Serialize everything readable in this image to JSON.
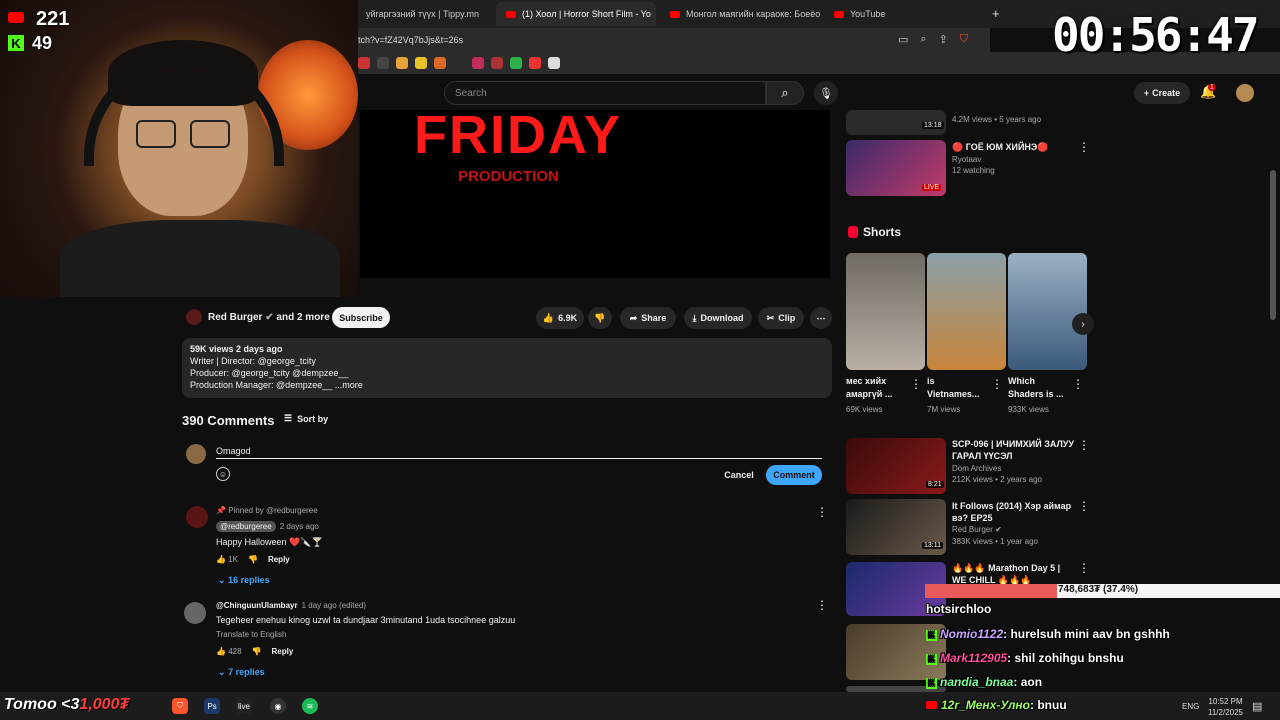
{
  "browser": {
    "tabs": [
      {
        "label": "уйгаргэзний түүх | Tippy.mn",
        "active": false
      },
      {
        "label": "(1) Хоол | Horror Short Film - Yo",
        "active": true
      },
      {
        "label": "Монгол маягийн караоке: Боеёо, А",
        "active": false
      },
      {
        "label": "YouTube",
        "active": false
      }
    ],
    "url": "tch?v=fZ42Vq7bJjs&t=26s",
    "new_tab": "+"
  },
  "stream": {
    "youtube_viewers": "221",
    "kick_viewers": "49",
    "timer": "00:56:47",
    "donation_bar": "748,683₮ (37.4%)",
    "donation_fraction": 0.374,
    "taskbar_overlay_name": "Tomoo <3",
    "taskbar_overlay_amount": "1,000₮",
    "chat": [
      {
        "user": "hotsirchloo",
        "text": ""
      },
      {
        "user": "Nomio1122",
        "text": ": hurelsuh mini aav bn gshhh"
      },
      {
        "user": "Mark112905",
        "text": ": shil zohihgu bnshu"
      },
      {
        "user": "nandia_bnaa",
        "text": ": aon"
      },
      {
        "user": "12r_Менх-Улно",
        "text": ": bnuu"
      }
    ]
  },
  "youtube": {
    "search_placeholder": "Search",
    "create_label": "Create",
    "notif_count": "1",
    "video_title_main": "FRIDAY",
    "video_title_sub": "PRODUCTION",
    "channel": "Red Burger",
    "channel_suffix": "and 2 more",
    "subscribe": "Subscribe",
    "likes": "6.9K",
    "share": "Share",
    "download": "Download",
    "clip": "Clip",
    "description": {
      "meta": "59K views  2 days ago",
      "lines": [
        "Writer | Director: @george_tcity",
        "Producer: @george_tcity @dempzee__",
        "Production Manager: @dempzee__   ...more"
      ]
    },
    "comments": {
      "count": "390 Comments",
      "sort": "Sort by",
      "input_value": "Omagod",
      "cancel": "Cancel",
      "submit": "Comment",
      "items": [
        {
          "pinned": "Pinned by @redburgeree",
          "author": "@redburgeree",
          "time": "2 days ago",
          "text": "Happy Halloween ❤️🔪🍸",
          "likes": "1K",
          "reply": "Reply",
          "replies": "16 replies"
        },
        {
          "author": "@ChinguunUlambayr",
          "time": "1 day ago (edited)",
          "text": "Tegeheer enehuu kinog uzwl ta dundjaar 3minutand 1uda tsocihnee galzuu",
          "translate": "Translate to English",
          "likes": "428",
          "reply": "Reply",
          "replies": "7 replies"
        }
      ]
    },
    "sidebar": {
      "top_items": [
        {
          "title": "",
          "meta1": "4.2M views",
          "meta2": "5 years ago",
          "duration": "13:18"
        },
        {
          "title": "🔴 ГОЁ ЮМ ХИЙНЭ🔴",
          "meta1": "Ryotaav",
          "meta2": "12 watching",
          "duration": "LIVE"
        }
      ],
      "shorts_label": "Shorts",
      "shorts": [
        {
          "title": "мес хийх амаргүй ...",
          "views": "69K views"
        },
        {
          "title": "is Vietnames...",
          "views": "7M views"
        },
        {
          "title": "Which Shaders is ...",
          "views": "933K views"
        }
      ],
      "videos": [
        {
          "title": "SCP-096 | ИЧИМХИЙ ЗАЛУУ ГАРАЛ ҮҮСЭЛ",
          "channel": "Dom Archives",
          "meta": "212K views • 2 years ago",
          "duration": "8:21"
        },
        {
          "title": "It Follows (2014) Хэр аймар вэ? EP25",
          "channel": "Red Burger",
          "meta": "383K views • 1 year ago",
          "duration": "13:11"
        },
        {
          "title": "🔥🔥🔥 Marathon Day 5 | WE CHILL 🔥🔥🔥",
          "channel": "",
          "meta": "",
          "duration": ""
        }
      ]
    }
  },
  "taskbar": {
    "lang": "ENG",
    "time": "10:52 PM",
    "date": "11/2/2025"
  },
  "colors": {
    "accent_blue": "#3ea6ff",
    "yt_red": "#ff0000",
    "kick_green": "#53fc18"
  }
}
